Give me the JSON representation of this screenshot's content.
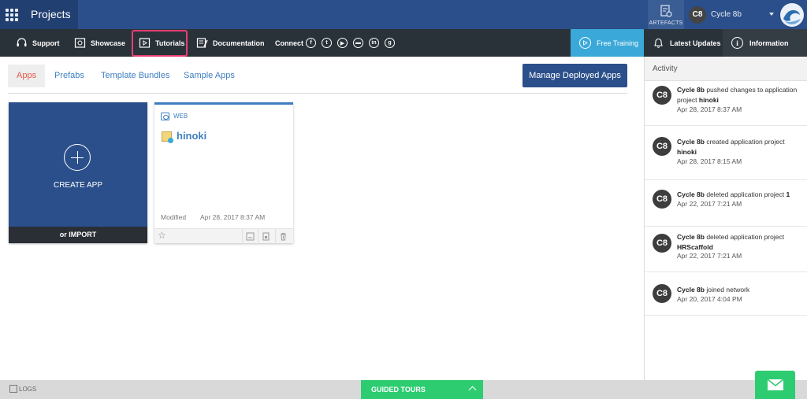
{
  "header": {
    "title": "Projects",
    "artefacts_label": "ARTEFACTS",
    "user": {
      "initials": "C8",
      "name": "Cycle 8b"
    }
  },
  "nav": {
    "support": "Support",
    "showcase": "Showcase",
    "tutorials": "Tutorials",
    "documentation": "Documentation",
    "connect": "Connect",
    "social_icons": [
      "facebook-icon",
      "twitter-icon",
      "youtube-icon",
      "chat-icon",
      "linkedin-icon",
      "googleplus-icon"
    ],
    "free_training": "Free Training",
    "latest_updates": "Latest Updates",
    "information": "Information"
  },
  "tabs": [
    {
      "label": "Apps",
      "active": true
    },
    {
      "label": "Prefabs",
      "active": false
    },
    {
      "label": "Template Bundles",
      "active": false
    },
    {
      "label": "Sample Apps",
      "active": false
    }
  ],
  "manage_button": "Manage Deployed Apps",
  "create_card": {
    "label": "CREATE APP",
    "import_label": "or IMPORT"
  },
  "app_card": {
    "type": "WEB",
    "name": "hinoki",
    "modified_label": "Modified",
    "modified_date": "Apr 28, 2017 8:37 AM"
  },
  "activity": {
    "title": "Activity",
    "items": [
      {
        "initials": "C8",
        "user": "Cycle 8b",
        "action": " pushed changes to application project ",
        "target": "hinoki",
        "time": "Apr 28, 2017 8:37 AM"
      },
      {
        "initials": "C8",
        "user": "Cycle 8b",
        "action": " created application project ",
        "target": "hinoki",
        "time": "Apr 28, 2017 8:15 AM"
      },
      {
        "initials": "C8",
        "user": "Cycle 8b",
        "action": " deleted application project ",
        "target": "1",
        "time": "Apr 22, 2017 7:21 AM"
      },
      {
        "initials": "C8",
        "user": "Cycle 8b",
        "action": " deleted application project ",
        "target": "HRScaffold",
        "time": "Apr 22, 2017 7:21 AM"
      },
      {
        "initials": "C8",
        "user": "Cycle 8b",
        "action": " joined network",
        "target": "",
        "time": "Apr 20, 2017 4:04 PM"
      }
    ]
  },
  "footer": {
    "logs": "LOGS",
    "guided_tours": "GUIDED TOURS"
  },
  "colors": {
    "primary": "#2b4f8a",
    "nav_dark": "#2a3239",
    "accent_blue": "#3aa8d8",
    "highlight": "#e83e74",
    "green": "#2ecc71",
    "tab_active": "#e35a4a"
  }
}
